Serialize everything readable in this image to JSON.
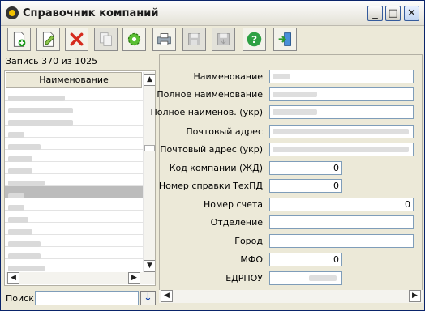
{
  "window": {
    "title": "Справочник компаний",
    "minimize": "_",
    "maximize": "□",
    "close": "✕"
  },
  "toolbar": {
    "items": [
      {
        "name": "add-record-button",
        "icon": "new-document-icon",
        "state": "enabled"
      },
      {
        "name": "edit-record-button",
        "icon": "edit-document-icon",
        "state": "enabled"
      },
      {
        "name": "delete-record-button",
        "icon": "red-x-icon",
        "state": "enabled"
      },
      {
        "name": "copy-record-button",
        "icon": "copy-icon",
        "state": "disabled"
      },
      {
        "name": "settings-button",
        "icon": "gear-icon",
        "state": "enabled"
      },
      {
        "name": "print-button",
        "icon": "printer-icon",
        "state": "enabled"
      },
      {
        "name": "save-button",
        "icon": "floppy-icon",
        "state": "disabled"
      },
      {
        "name": "save-as-button",
        "icon": "floppy-arrow-icon",
        "state": "disabled"
      },
      {
        "name": "help-button",
        "icon": "help-icon",
        "state": "enabled"
      },
      {
        "name": "exit-button",
        "icon": "exit-door-icon",
        "state": "enabled"
      }
    ]
  },
  "list": {
    "record_status": "Запись 370 из 1025",
    "column_header": "Наименование",
    "selected_row_index": 8,
    "row_count": 16
  },
  "search": {
    "label": "Поиск",
    "value": "",
    "button": "↓"
  },
  "form": {
    "name": {
      "label": "Наименование",
      "value": ""
    },
    "full_name": {
      "label": "Полное наименование",
      "value": ""
    },
    "full_name_ukr": {
      "label": "Полное наименов. (укр)",
      "value": ""
    },
    "postal_address": {
      "label": "Почтовый адрес",
      "value": ""
    },
    "postal_address_ukr": {
      "label": "Почтовый адрес (укр)",
      "value": ""
    },
    "company_code": {
      "label": "Код компании (ЖД)",
      "value": "0"
    },
    "techpd_number": {
      "label": "Номер справки ТехПД",
      "value": "0"
    },
    "account_number": {
      "label": "Номер счета",
      "value": "0"
    },
    "branch": {
      "label": "Отделение",
      "value": ""
    },
    "city": {
      "label": "Город",
      "value": ""
    },
    "mfo": {
      "label": "МФО",
      "value": "0"
    },
    "edrpou": {
      "label": "ЕДРПОУ",
      "value": ""
    }
  },
  "colors": {
    "accent": "#0a246a",
    "selected_row": "#bcbcbc",
    "panel_bg": "#ece9d8"
  }
}
